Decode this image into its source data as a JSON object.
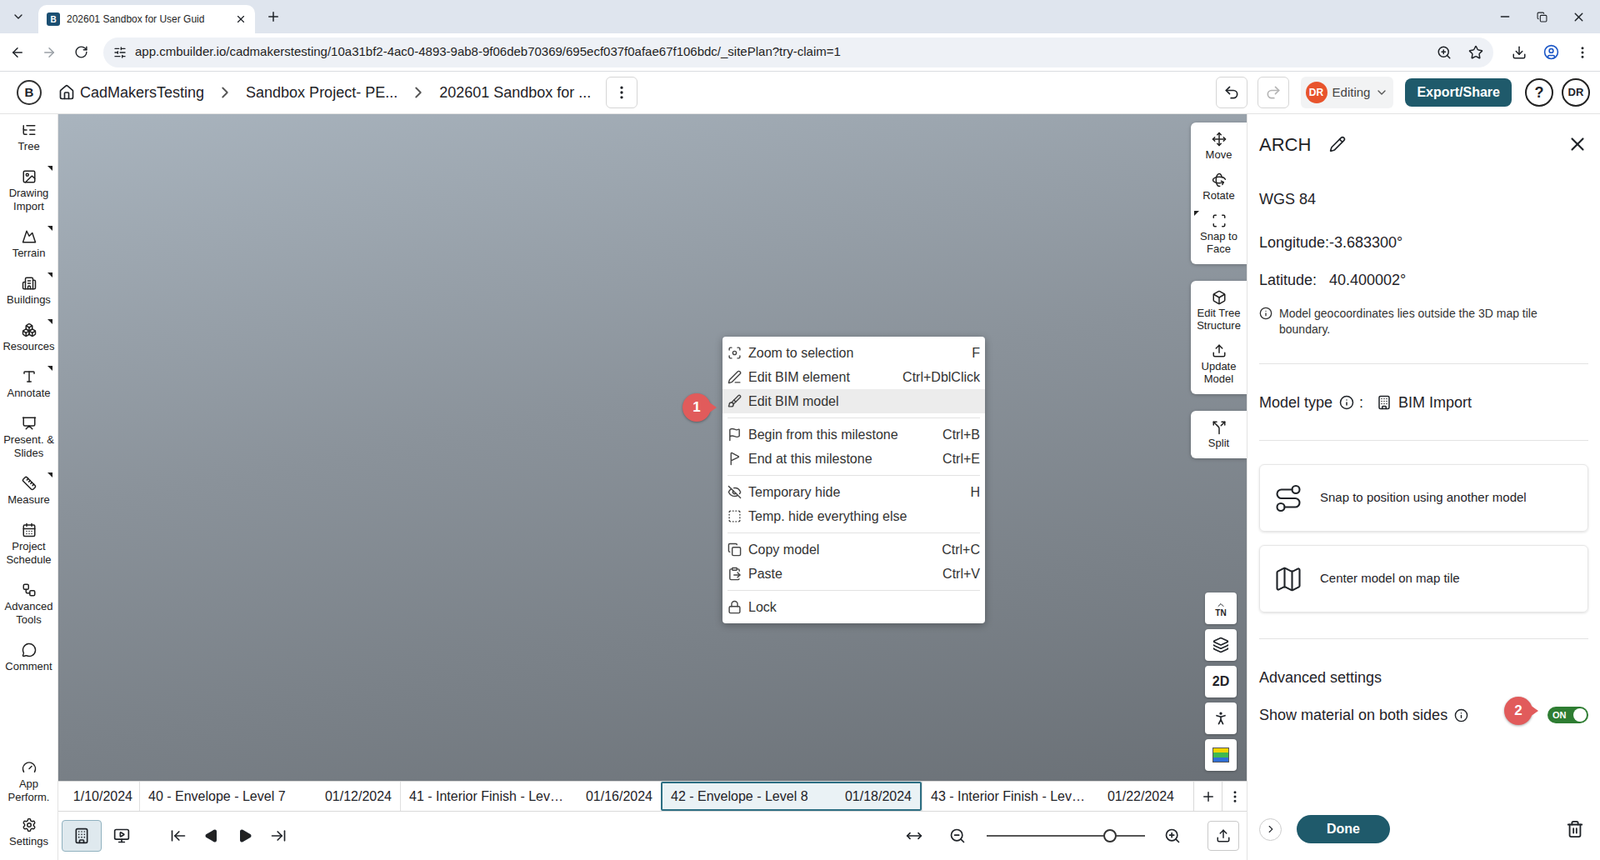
{
  "browser": {
    "tab": {
      "favicon": "B",
      "title": "202601 Sandbox for User Guid"
    },
    "url": "app.cmbuilder.io/cadmakerstesting/10a31bf2-4ac0-4893-9ab8-9f06deb70369/695ecf037f0afae67f106bdc/_sitePlan?try-claim=1"
  },
  "app": {
    "logo": "B",
    "breadcrumbs": [
      "CadMakersTesting",
      "Sandbox Project- PE...",
      "202601 Sandbox for ..."
    ],
    "user": {
      "initials": "DR",
      "mode": "Editing"
    },
    "export_button": "Export/Share",
    "help": "?",
    "profile": "DR"
  },
  "sidebar": {
    "items": [
      {
        "label": "Tree",
        "has_submenu": false
      },
      {
        "label": "Drawing Import",
        "has_submenu": true
      },
      {
        "label": "Terrain",
        "has_submenu": true
      },
      {
        "label": "Buildings",
        "has_submenu": true
      },
      {
        "label": "Resources",
        "has_submenu": true
      },
      {
        "label": "Annotate",
        "has_submenu": true
      },
      {
        "label": "Present. & Slides",
        "has_submenu": false
      },
      {
        "label": "Measure",
        "has_submenu": true
      },
      {
        "label": "Project Schedule",
        "has_submenu": false
      },
      {
        "label": "Advanced Tools",
        "has_submenu": false
      },
      {
        "label": "Comment",
        "has_submenu": false
      }
    ],
    "bottom_items": [
      {
        "label": "App Perform.",
        "has_submenu": false
      },
      {
        "label": "Settings",
        "has_submenu": false
      }
    ]
  },
  "context_menu": {
    "groups": [
      [
        {
          "label": "Zoom to selection",
          "shortcut": "F",
          "hovered": false
        },
        {
          "label": "Edit BIM element",
          "shortcut": "Ctrl+DblClick",
          "hovered": false
        },
        {
          "label": "Edit BIM model",
          "hovered": true
        }
      ],
      [
        {
          "label": "Begin from this milestone",
          "shortcut": "Ctrl+B",
          "hovered": false
        },
        {
          "label": "End at this milestone",
          "shortcut": "Ctrl+E",
          "hovered": false
        }
      ],
      [
        {
          "label": "Temporary hide",
          "shortcut": "H",
          "hovered": false
        },
        {
          "label": "Temp. hide everything else",
          "hovered": false
        }
      ],
      [
        {
          "label": "Copy model",
          "shortcut": "Ctrl+C",
          "hovered": false
        },
        {
          "label": "Paste",
          "shortcut": "Ctrl+V",
          "hovered": false
        }
      ],
      [
        {
          "label": "Lock",
          "hovered": false
        }
      ]
    ]
  },
  "callouts": [
    "1",
    "2"
  ],
  "view_toolbar": {
    "groups": [
      [
        {
          "label": "Move",
          "has_submenu": false
        },
        {
          "label": "Rotate",
          "has_submenu": false
        },
        {
          "label": "Snap to Face",
          "has_submenu": true
        }
      ],
      [
        {
          "label": "Edit Tree Structure",
          "has_submenu": false
        },
        {
          "label": "Update Model",
          "has_submenu": false
        }
      ],
      [
        {
          "label": "Split",
          "has_submenu": false
        }
      ]
    ],
    "compass": "TN",
    "mode": "2D"
  },
  "panel": {
    "title": "ARCH",
    "crs": "WGS 84",
    "coordinates": [
      {
        "label": "Longitude:",
        "value": "-3.683300°"
      },
      {
        "label": "Latitude:",
        "value": "40.400002°"
      }
    ],
    "notice": "Model geocoordinates lies outside the 3D map tile boundary.",
    "model_type": {
      "label": "Model type",
      "separator": ":",
      "value": "BIM Import"
    },
    "actions": [
      "Snap to position using another model",
      "Center model on map tile"
    ],
    "advanced": {
      "title": "Advanced settings",
      "settings": [
        {
          "label": "Show material on both sides",
          "on": true,
          "state_label": "ON"
        }
      ]
    },
    "done": "Done"
  },
  "timeline": {
    "leading_date": "1/10/2024",
    "milestones": [
      {
        "name": "40 - Envelope - Level 7",
        "date": "01/12/2024",
        "selected": false
      },
      {
        "name": "41 - Interior Finish - Lev…",
        "date": "01/16/2024",
        "selected": false
      },
      {
        "name": "42 - Envelope - Level 8",
        "date": "01/18/2024",
        "selected": true
      },
      {
        "name": "43 - Interior Finish - Lev…",
        "date": "01/22/2024",
        "selected": false
      }
    ]
  },
  "playback": {
    "views": [
      {
        "selected": true
      },
      {
        "selected": false
      }
    ],
    "zoom": {
      "level": 0.78
    }
  }
}
